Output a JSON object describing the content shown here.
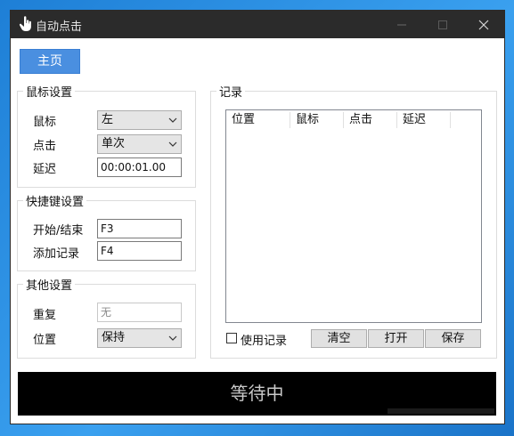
{
  "window": {
    "title": "自动点击",
    "app_icon": "hand-pointer-icon"
  },
  "nav": {
    "home_label": "主页"
  },
  "mouse_settings": {
    "title": "鼠标设置",
    "button_label": "鼠标",
    "button_value": "左",
    "click_label": "点击",
    "click_value": "单次",
    "delay_label": "延迟",
    "delay_value": "00:00:01.00"
  },
  "hotkey_settings": {
    "title": "快捷键设置",
    "startstop_label": "开始/结束",
    "startstop_value": "F3",
    "addrecord_label": "添加记录",
    "addrecord_value": "F4"
  },
  "other_settings": {
    "title": "其他设置",
    "repeat_label": "重复",
    "repeat_value": "无",
    "position_label": "位置",
    "position_value": "保持"
  },
  "records": {
    "title": "记录",
    "columns": [
      "位置",
      "鼠标",
      "点击",
      "延迟"
    ],
    "rows": [],
    "use_records_label": "使用记录",
    "use_records_checked": false,
    "clear_label": "清空",
    "open_label": "打开",
    "save_label": "保存"
  },
  "status": {
    "text": "等待中"
  },
  "colors": {
    "titlebar": "#2b2b2b",
    "accent": "#4a8fe0",
    "status_bg": "#000000",
    "desktop": "#2a8ae0"
  }
}
